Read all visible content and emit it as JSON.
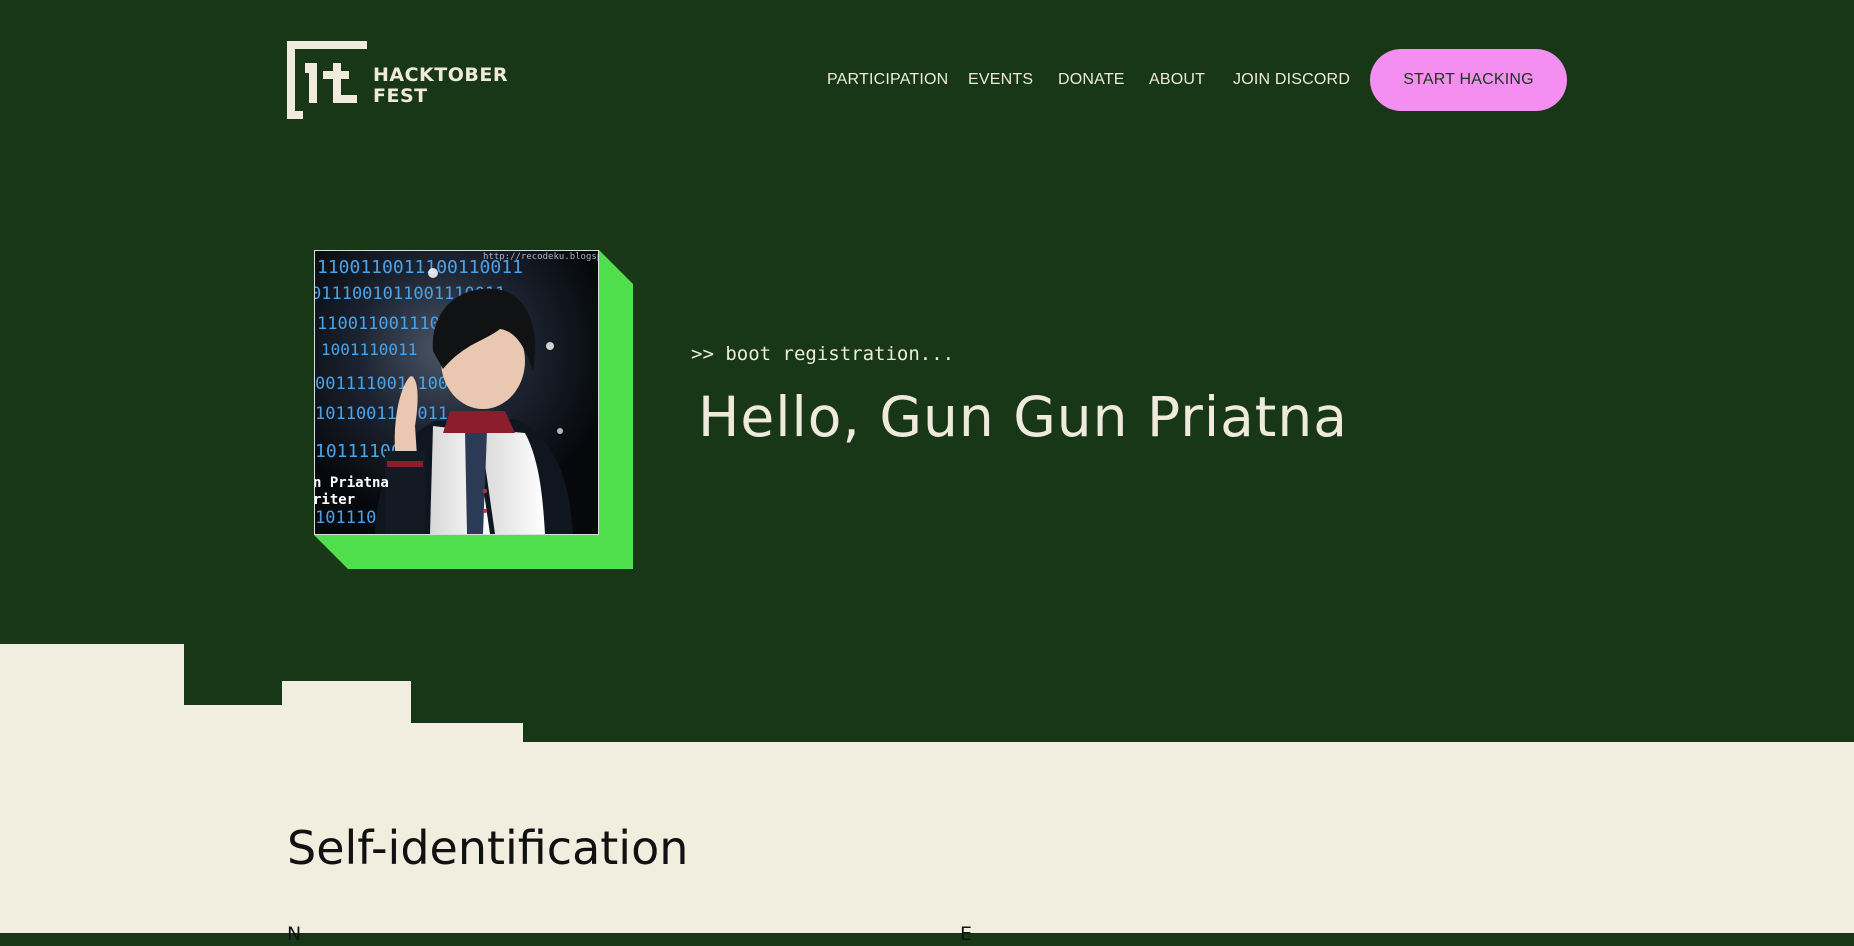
{
  "header": {
    "logo_text_line1": "HACKTOBER",
    "logo_text_line2": "FEST",
    "nav": [
      {
        "label": "PARTICIPATION"
      },
      {
        "label": "EVENTS"
      },
      {
        "label": "DONATE"
      },
      {
        "label": "ABOUT"
      },
      {
        "label": "JOIN DISCORD"
      }
    ],
    "cta_label": "START HACKING"
  },
  "hero": {
    "boot_text": ">> boot registration...",
    "greeting": "Hello, Gun Gun Priatna",
    "avatar_overlay": {
      "binary_lines": [
        "1100110011100110011",
        "0111001011001110011",
        "11001100111001",
        "1001110011",
        "0011110011100",
        "1011001110011",
        "1011110011",
        "1011101"
      ],
      "url_text": "http://recodeku.blogspot",
      "name_text": "n Priatna",
      "role_text": "riter"
    }
  },
  "colors": {
    "background_dark": "#183717",
    "cream": "#f2eedf",
    "accent_pink": "#f48ff1",
    "accent_green": "#50df4d",
    "text_light": "#efeadc"
  },
  "form": {
    "section_title": "Self-identification",
    "name_label": "N",
    "email_label": "E"
  }
}
